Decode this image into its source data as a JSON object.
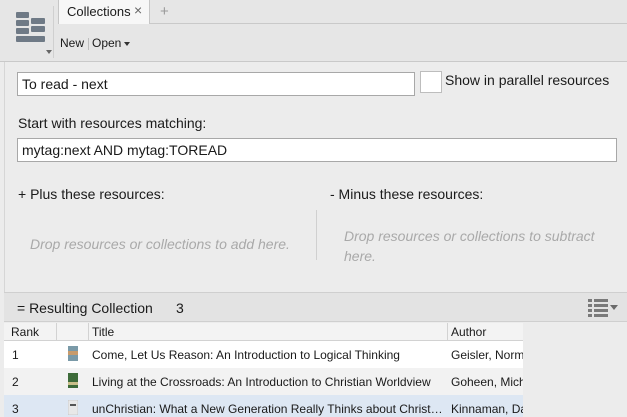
{
  "tab": {
    "title": "Collections",
    "close": "×",
    "add": "+"
  },
  "toolbar": {
    "new_label": "New",
    "open_label": "Open"
  },
  "collection": {
    "name": "To read - next",
    "parallel_label": "Show in parallel resources",
    "start_label": "Start with resources matching:",
    "query": "mytag:next AND mytag:TOREAD",
    "plus_label": "+ Plus these resources:",
    "minus_label": "- Minus these resources:",
    "drop_add": "Drop resources or collections to add here.",
    "drop_subtract": "Drop resources or collections to subtract here."
  },
  "results": {
    "label": "= Resulting Collection",
    "count": "3",
    "columns": {
      "rank": "Rank",
      "title": "Title",
      "author": "Author"
    },
    "rows": [
      {
        "rank": "1",
        "title": "Come, Let Us Reason: An Introduction to Logical Thinking",
        "author": "Geisler, Norm"
      },
      {
        "rank": "2",
        "title": "Living at the Crossroads: An Introduction to Christian Worldview",
        "author": "Goheen, Mich"
      },
      {
        "rank": "3",
        "title": "unChristian: What a New Generation Really Thinks about Christ…",
        "author": "Kinnaman, Da"
      }
    ]
  },
  "colors": {
    "selection": "#dde7f3",
    "cover1": "#7a9aa8",
    "cover2": "#3d6b3a",
    "cover3": "#e8e8e8"
  }
}
